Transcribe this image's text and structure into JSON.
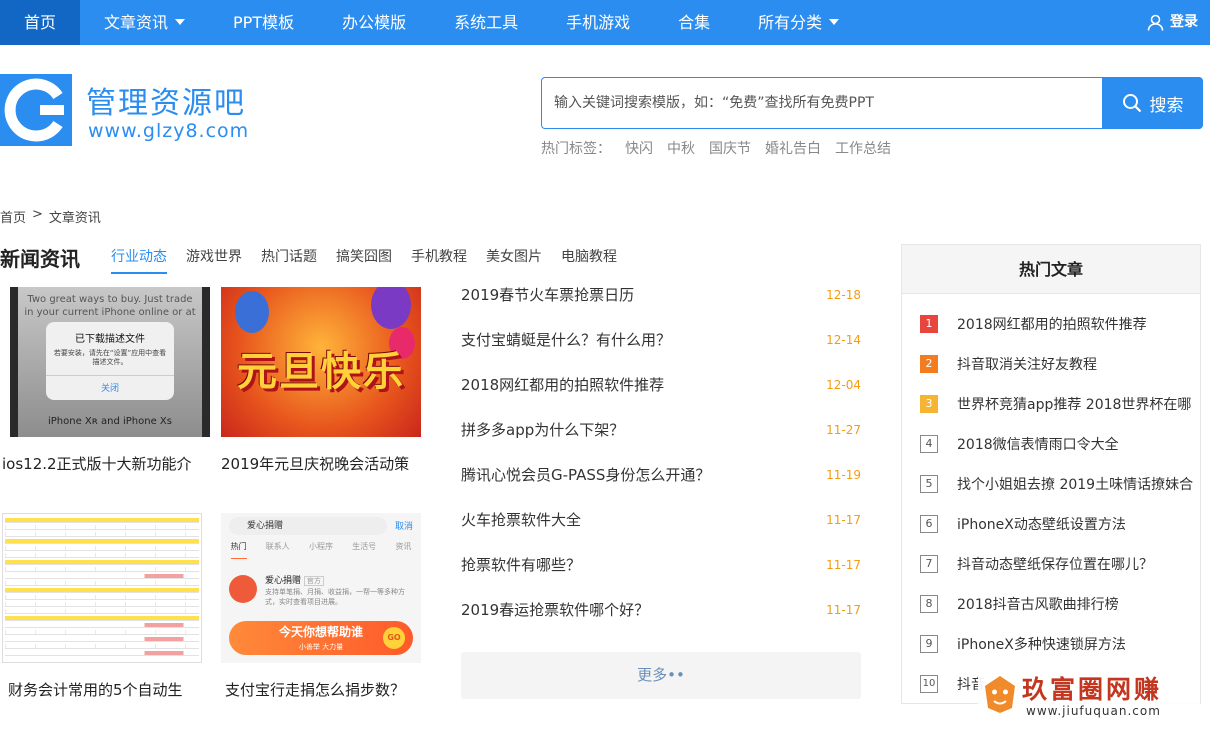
{
  "nav": {
    "items": [
      {
        "label": "首页",
        "active": true,
        "dropdown": false
      },
      {
        "label": "文章资讯",
        "active": false,
        "dropdown": true
      },
      {
        "label": "PPT模板",
        "active": false,
        "dropdown": false
      },
      {
        "label": "办公模版",
        "active": false,
        "dropdown": false
      },
      {
        "label": "系统工具",
        "active": false,
        "dropdown": false
      },
      {
        "label": "手机游戏",
        "active": false,
        "dropdown": false
      },
      {
        "label": "合集",
        "active": false,
        "dropdown": false
      },
      {
        "label": "所有分类",
        "active": false,
        "dropdown": true
      }
    ],
    "login_label": "登录",
    "login_icon": "user-icon"
  },
  "header": {
    "logo_text": "管理资源吧",
    "logo_url": "www.glzy8.com",
    "search_placeholder": "输入关键词搜索模版，如：“免费”查找所有免费PPT",
    "search_button": "搜索",
    "hot_tags_label": "热门标签：",
    "hot_tags": [
      "快闪",
      "中秋",
      "国庆节",
      "婚礼告白",
      "工作总结"
    ]
  },
  "breadcrumb": {
    "home": "首页",
    "separator": ">",
    "current": "文章资讯"
  },
  "news": {
    "title": "新闻资讯",
    "tabs": [
      "行业动态",
      "游戏世界",
      "热门话题",
      "搞笑囧图",
      "手机教程",
      "美女图片",
      "电脑教程"
    ],
    "cards": [
      {
        "caption": "ios12.2正式版十大新功能介"
      },
      {
        "caption": "2019年元旦庆祝晚会活动策"
      },
      {
        "caption": "财务会计常用的5个自动生"
      },
      {
        "caption": "支付宝行走捐怎么捐步数？"
      }
    ],
    "thumb_phone": {
      "tagline": "Two great ways to buy. Just trade in your current iPhone online or at",
      "dialog_title": "已下载描述文件",
      "dialog_body": "若要安装，请先在“设置”应用中查看描述文件。",
      "dialog_button": "关闭",
      "model": "iPhone Xʀ and iPhone Xs"
    },
    "thumb_newyear": {
      "text": "元旦快乐"
    },
    "thumb_alipay": {
      "search": "爱心捐赠",
      "cancel": "取消",
      "tabs": [
        "热门",
        "联系人",
        "小程序",
        "生活号",
        "资讯"
      ],
      "name": "爱心捐赠",
      "badge": "官方",
      "desc": "支持单笔捐、月捐、收益捐，一帮一等多种方式，实时查看项目进展。",
      "banner": "今天你想帮助谁",
      "banner_sub": "小善举 大力量",
      "go": "GO"
    },
    "articles": [
      {
        "title": "2019春节火车票抢票日历",
        "date": "12-18"
      },
      {
        "title": "支付宝蜻蜓是什么？有什么用？",
        "date": "12-14"
      },
      {
        "title": "2018网红都用的拍照软件推荐",
        "date": "12-04"
      },
      {
        "title": "拼多多app为什么下架？",
        "date": "11-27"
      },
      {
        "title": "腾讯心悦会员G-PASS身份怎么开通？",
        "date": "11-19"
      },
      {
        "title": "火车抢票软件大全",
        "date": "11-17"
      },
      {
        "title": "抢票软件有哪些？",
        "date": "11-17"
      },
      {
        "title": "2019春运抢票软件哪个好？",
        "date": "11-17"
      }
    ],
    "more_label": "更多••"
  },
  "hot": {
    "title": "热门文章",
    "items": [
      {
        "rank": "1",
        "title": "2018网红都用的拍照软件推荐"
      },
      {
        "rank": "2",
        "title": "抖音取消关注好友教程"
      },
      {
        "rank": "3",
        "title": "世界杯竞猜app推荐 2018世界杯在哪"
      },
      {
        "rank": "4",
        "title": "2018微信表情雨口令大全"
      },
      {
        "rank": "5",
        "title": "找个小姐姐去撩 2019土味情话撩妹合"
      },
      {
        "rank": "6",
        "title": "iPhoneX动态壁纸设置方法"
      },
      {
        "rank": "7",
        "title": "抖音动态壁纸保存位置在哪儿？"
      },
      {
        "rank": "8",
        "title": "2018抖音古风歌曲排行榜"
      },
      {
        "rank": "9",
        "title": "iPhoneX多种快速锁屏方法"
      },
      {
        "rank": "10",
        "title": "抖音"
      }
    ]
  },
  "watermark": {
    "text": "玖富圈网赚",
    "url": "www.jiufuquan.com"
  },
  "colors": {
    "brand": "#2b8df0",
    "nav_active": "#1266c4",
    "date": "#f39c12",
    "rank1": "#e8453c",
    "rank2": "#f47c20",
    "rank3": "#f5b433"
  }
}
